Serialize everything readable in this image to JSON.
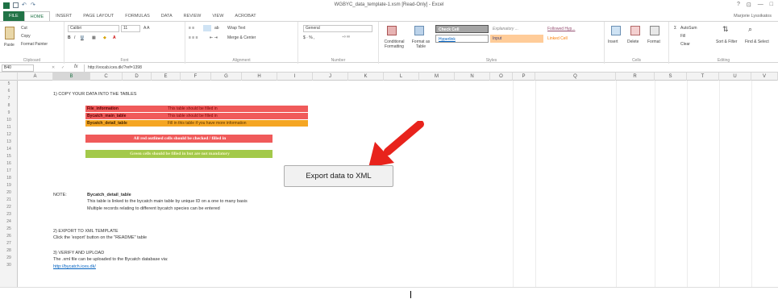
{
  "window": {
    "title": "WGBYC_data_template-1.xsm [Read-Only] - Excel",
    "controls": [
      "?",
      "⊡",
      "—",
      "□"
    ]
  },
  "ribbon_tabs": [
    "FILE",
    "HOME",
    "INSERT",
    "PAGE LAYOUT",
    "FORMULAS",
    "DATA",
    "REVIEW",
    "VIEW",
    "ACROBAT"
  ],
  "user_name": "Marjorie Lyssikatos",
  "ribbon": {
    "clipboard": {
      "cut": "Cut",
      "copy": "Copy",
      "painter": "Format Painter",
      "paste": "Paste",
      "label": "Clipboard"
    },
    "font": {
      "name": "Calibri",
      "size": "11",
      "label": "Font"
    },
    "alignment": {
      "wrap": "Wrap Text",
      "merge": "Merge & Center",
      "label": "Alignment"
    },
    "number": {
      "format": "General",
      "label": "Number"
    },
    "styles": {
      "conditional": "Conditional Formatting",
      "format_table": "Format as Table",
      "check_cell": "Check Cell",
      "explanatory": "Explanatory ...",
      "followed": "Followed Hyp...",
      "hyperlink": "Hyperlink",
      "input": "Input",
      "linked": "Linked Cell",
      "label": "Styles"
    },
    "cells": {
      "insert": "Insert",
      "delete": "Delete",
      "format": "Format",
      "label": "Cells"
    },
    "editing": {
      "autosum": "AutoSum",
      "fill": "Fill",
      "clear": "Clear",
      "sort": "Sort & Filter",
      "find": "Find & Select",
      "label": "Editing"
    }
  },
  "formula_bar": {
    "name_box": "B40",
    "fx": "fx",
    "content": "http://vocab.ices.dk/?ref=1398"
  },
  "columns": [
    "A",
    "B",
    "C",
    "D",
    "E",
    "F",
    "G",
    "H",
    "I",
    "J",
    "K",
    "L",
    "M",
    "N",
    "O",
    "P",
    "Q",
    "R",
    "S",
    "T",
    "U",
    "V"
  ],
  "rows": [
    "5",
    "6",
    "7",
    "8",
    "9",
    "10",
    "11",
    "12",
    "13",
    "14",
    "15",
    "16",
    "17",
    "18",
    "19",
    "20",
    "21",
    "22",
    "23",
    "24",
    "25",
    "26",
    "27",
    "28",
    "29",
    "30"
  ],
  "sheet": {
    "step1": "1) COPY YOUR DATA INTO THE TABLES",
    "file_information": {
      "name": "File_information",
      "note": "This table should be filled in"
    },
    "bycatch_main": {
      "name": "Bycatch_main_table",
      "note": "This table should be filled in"
    },
    "bycatch_detail": {
      "name": "Bycatch_detail_table",
      "note": "Fill in this table if you have more information"
    },
    "red_note": "All red outlined cells should be checked / filled in",
    "green_note": "Green cells should be filled in but are not mandatory",
    "export_button": "Export data to XML",
    "note_label": "NOTE:",
    "note_title": "Bycatch_detail_table",
    "note_line1": "This table is linked to the bycatch main table by unique ID on a one to many basis",
    "note_line2": "Multiple records relating to different bycatch species can be entered",
    "step2": "2) EXPORT TO XML TEMPLATE",
    "step2_text": "Click the 'export' button on the \"README\" table",
    "step3": "3) VERIFY AND UPLOAD",
    "step3_text": "The .xml file can be uploaded to the Bycatch database via:",
    "link": "http://bycatch.ices.dk/"
  },
  "colors": {
    "excel_green": "#217346",
    "red_fill": "#f05a5a",
    "orange_fill": "#f5a623",
    "green_fill": "#a3c94a",
    "arrow_red": "#e8231c",
    "check_cell": "#a5a5a5"
  }
}
